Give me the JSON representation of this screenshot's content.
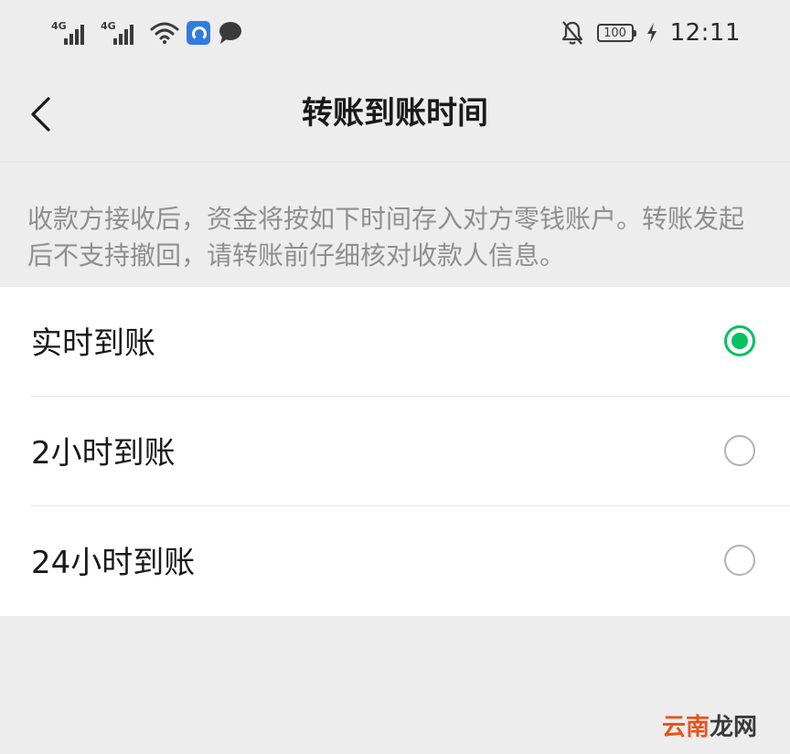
{
  "status_bar": {
    "network_1": "4G",
    "network_2": "4G",
    "battery": "100",
    "time": "12:11",
    "icons": [
      "signal-icon",
      "signal-icon",
      "wifi-icon",
      "app-icon",
      "message-icon",
      "bell-off-icon",
      "battery-icon",
      "charging-icon"
    ]
  },
  "header": {
    "title": "转账到账时间",
    "back_icon": "chevron-left-icon"
  },
  "notice": {
    "text": "收款方接收后，资金将按如下时间存入对方零钱账户。转账发起后不支持撤回，请转账前仔细核对收款人信息。"
  },
  "options": [
    {
      "label": "实时到账",
      "selected": true
    },
    {
      "label": "2小时到账",
      "selected": false
    },
    {
      "label": "24小时到账",
      "selected": false
    }
  ],
  "watermark": {
    "part1": "云南",
    "part2": "龙网"
  },
  "colors": {
    "accent": "#07c160",
    "background": "#ededed",
    "notice_text": "#8f8f8f"
  }
}
